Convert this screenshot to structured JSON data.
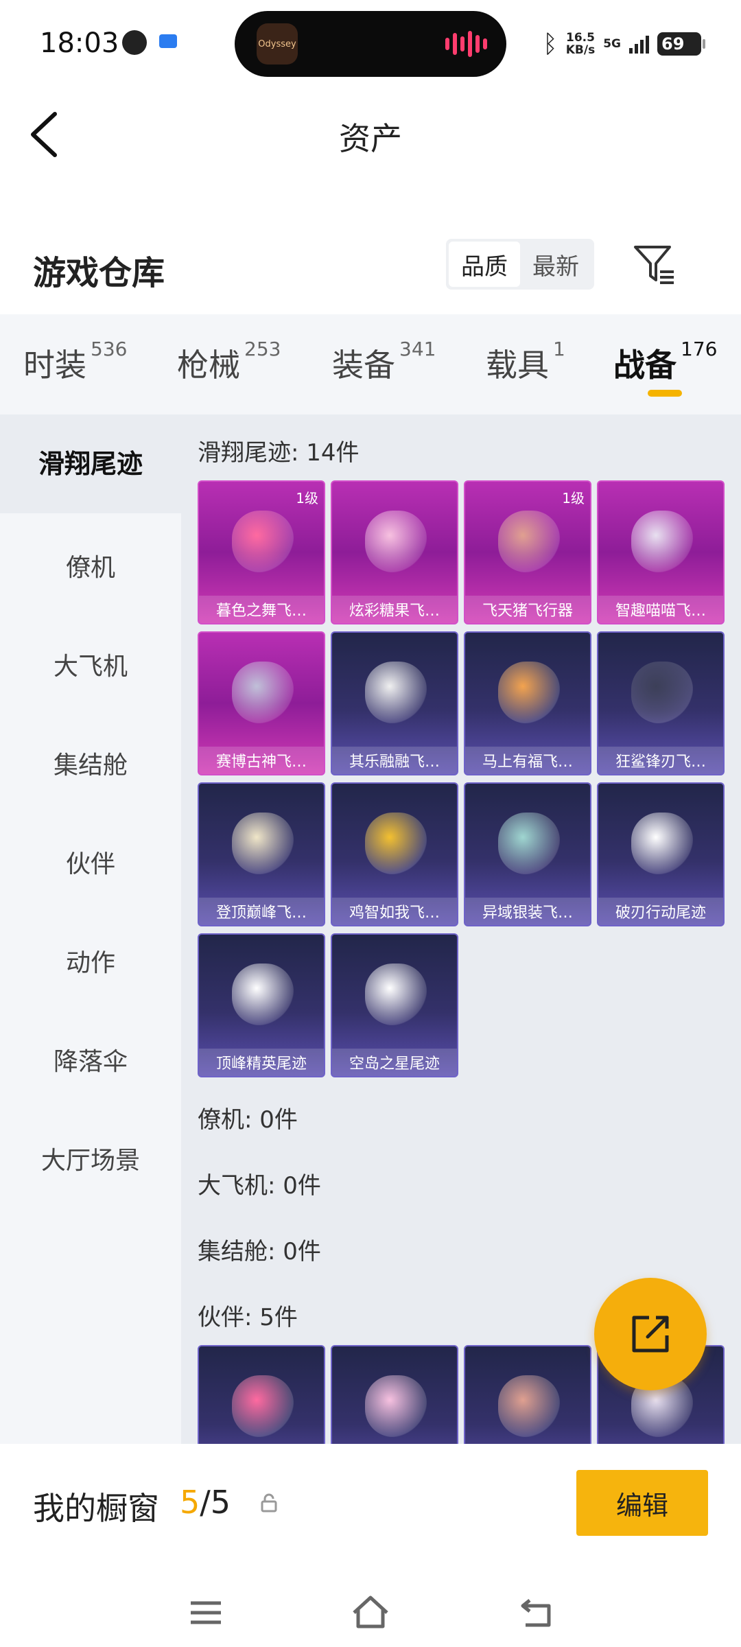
{
  "status_bar": {
    "time": "18:03",
    "island_app": "Odyssey",
    "net_speed_value": "16.5",
    "net_speed_unit": "KB/s",
    "network": "5G",
    "battery": "69"
  },
  "header": {
    "title": "资产"
  },
  "warehouse": {
    "title": "游戏仓库",
    "sort": {
      "quality": "品质",
      "newest": "最新",
      "active": "quality"
    }
  },
  "tabs": [
    {
      "label": "时装",
      "count": "536"
    },
    {
      "label": "枪械",
      "count": "253"
    },
    {
      "label": "装备",
      "count": "341"
    },
    {
      "label": "载具",
      "count": "1"
    },
    {
      "label": "战备",
      "count": "176"
    }
  ],
  "sidebar": {
    "items": [
      "滑翔尾迹",
      "僚机",
      "大飞机",
      "集结舱",
      "伙伴",
      "动作",
      "降落伞",
      "大厅场景"
    ],
    "active_index": 0
  },
  "sections": {
    "glide": {
      "title": "滑翔尾迹: 14件"
    },
    "wingman": {
      "title": "僚机: 0件"
    },
    "big_plane": {
      "title": "大飞机: 0件"
    },
    "assembly_pod": {
      "title": "集结舱: 0件"
    },
    "partner": {
      "title": "伙伴: 5件"
    }
  },
  "glide_items": [
    {
      "name": "暮色之舞飞…",
      "level": "1级",
      "rarity": "purple"
    },
    {
      "name": "炫彩糖果飞…",
      "level": "",
      "rarity": "purple"
    },
    {
      "name": "飞天猪飞行器",
      "level": "1级",
      "rarity": "purple"
    },
    {
      "name": "智趣喵喵飞…",
      "level": "",
      "rarity": "purple"
    },
    {
      "name": "赛博古神飞…",
      "level": "",
      "rarity": "purple"
    },
    {
      "name": "其乐融融飞…",
      "level": "",
      "rarity": "navy"
    },
    {
      "name": "马上有福飞…",
      "level": "",
      "rarity": "navy"
    },
    {
      "name": "狂鲨锋刃飞…",
      "level": "",
      "rarity": "navy"
    },
    {
      "name": "登顶巅峰飞…",
      "level": "",
      "rarity": "navy"
    },
    {
      "name": "鸡智如我飞…",
      "level": "",
      "rarity": "navy"
    },
    {
      "name": "异域银装飞…",
      "level": "",
      "rarity": "navy"
    },
    {
      "name": "破刃行动尾迹",
      "level": "",
      "rarity": "navy"
    },
    {
      "name": "顶峰精英尾迹",
      "level": "",
      "rarity": "navy"
    },
    {
      "name": "空岛之星尾迹",
      "level": "",
      "rarity": "navy"
    }
  ],
  "partner_items": [
    {
      "rarity": "navy"
    },
    {
      "rarity": "navy"
    },
    {
      "rarity": "navy"
    },
    {
      "rarity": "navy"
    }
  ],
  "showcase": {
    "label": "我的橱窗",
    "current": "5",
    "separator": "/",
    "total": "5",
    "edit_label": "编辑"
  },
  "colors": {
    "accent": "#f5b300",
    "rare_purple": "#b82fb3",
    "rare_navy": "#34316a"
  }
}
